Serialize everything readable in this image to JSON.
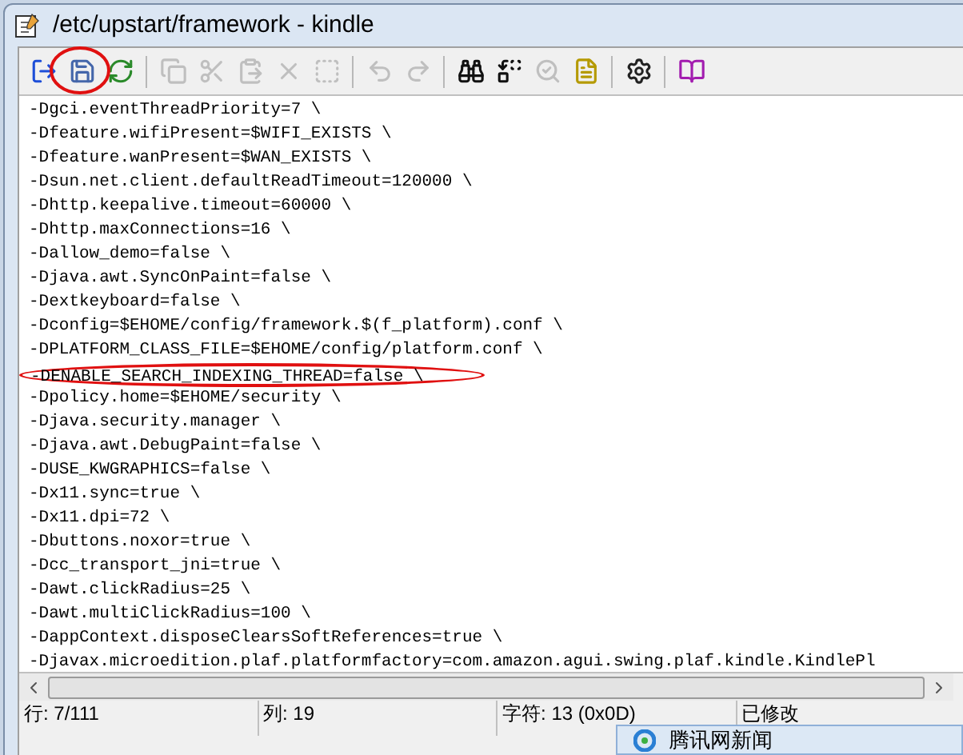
{
  "window": {
    "title": "/etc/upstart/framework - kindle"
  },
  "toolbar": [
    {
      "kind": "exit",
      "disabled": false
    },
    {
      "kind": "save",
      "disabled": false
    },
    {
      "kind": "reload",
      "disabled": false
    },
    {
      "kind": "sep"
    },
    {
      "kind": "copy",
      "disabled": true
    },
    {
      "kind": "cut",
      "disabled": true
    },
    {
      "kind": "paste",
      "disabled": true
    },
    {
      "kind": "delete",
      "disabled": true
    },
    {
      "kind": "selectall",
      "disabled": true
    },
    {
      "kind": "sep"
    },
    {
      "kind": "undo",
      "disabled": true
    },
    {
      "kind": "redo",
      "disabled": true
    },
    {
      "kind": "sep"
    },
    {
      "kind": "find",
      "disabled": false
    },
    {
      "kind": "replace",
      "disabled": false
    },
    {
      "kind": "findnext",
      "disabled": true
    },
    {
      "kind": "goto",
      "disabled": false
    },
    {
      "kind": "sep"
    },
    {
      "kind": "settings",
      "disabled": false
    },
    {
      "kind": "sep"
    },
    {
      "kind": "help",
      "disabled": false
    }
  ],
  "editor": {
    "lines": [
      {
        "text": "-Dgci.eventThreadPriority=7 \\",
        "circled": false
      },
      {
        "text": "-Dfeature.wifiPresent=$WIFI_EXISTS \\",
        "circled": false
      },
      {
        "text": "-Dfeature.wanPresent=$WAN_EXISTS \\",
        "circled": false
      },
      {
        "text": "-Dsun.net.client.defaultReadTimeout=120000 \\",
        "circled": false
      },
      {
        "text": "-Dhttp.keepalive.timeout=60000 \\",
        "circled": false
      },
      {
        "text": "-Dhttp.maxConnections=16 \\",
        "circled": false
      },
      {
        "text": "-Dallow_demo=false \\",
        "circled": false
      },
      {
        "text": "-Djava.awt.SyncOnPaint=false \\",
        "circled": false
      },
      {
        "text": "-Dextkeyboard=false \\",
        "circled": false
      },
      {
        "text": "-Dconfig=$EHOME/config/framework.$(f_platform).conf \\",
        "circled": false
      },
      {
        "text": "-DPLATFORM_CLASS_FILE=$EHOME/config/platform.conf \\",
        "circled": false
      },
      {
        "text": "-DENABLE_SEARCH_INDEXING_THREAD=false \\",
        "circled": true
      },
      {
        "text": "-Dpolicy.home=$EHOME/security \\",
        "circled": false
      },
      {
        "text": "-Djava.security.manager \\",
        "circled": false
      },
      {
        "text": "-Djava.awt.DebugPaint=false \\",
        "circled": false
      },
      {
        "text": "-DUSE_KWGRAPHICS=false \\",
        "circled": false
      },
      {
        "text": "-Dx11.sync=true \\",
        "circled": false
      },
      {
        "text": "-Dx11.dpi=72 \\",
        "circled": false
      },
      {
        "text": "-Dbuttons.noxor=true \\",
        "circled": false
      },
      {
        "text": "-Dcc_transport_jni=true \\",
        "circled": false
      },
      {
        "text": "-Dawt.clickRadius=25 \\",
        "circled": false
      },
      {
        "text": "-Dawt.multiClickRadius=100 \\",
        "circled": false
      },
      {
        "text": "-DappContext.disposeClearsSoftReferences=true \\",
        "circled": false
      },
      {
        "text": "-Djavax.microedition.plaf.platformfactory=com.amazon.agui.swing.plaf.kindle.KindlePl",
        "circled": false
      }
    ]
  },
  "status_bar": [
    "行: 7/111",
    "列: 19",
    "字符: 13 (0x0D)",
    "已修改"
  ],
  "notification": {
    "title": "腾讯网新闻"
  }
}
